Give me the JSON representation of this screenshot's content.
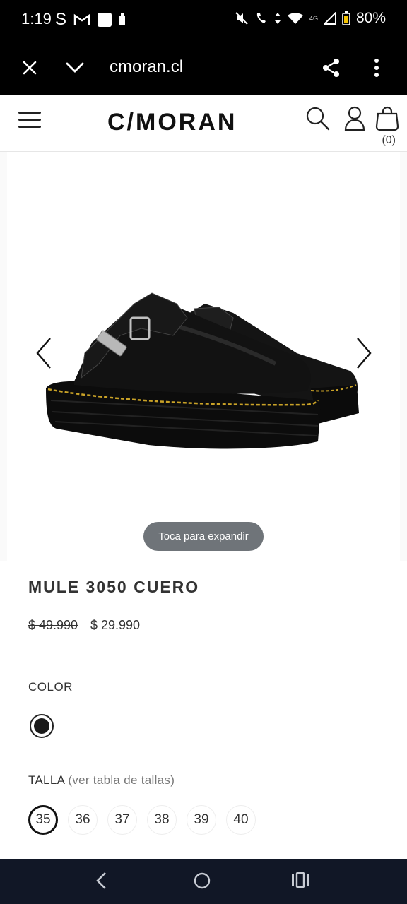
{
  "status_bar": {
    "time": "1:19",
    "battery": "80%"
  },
  "browser": {
    "url": "cmoran.cl"
  },
  "header": {
    "logo": "C/MORAN",
    "cart_count": "(0)"
  },
  "product": {
    "image_hint": "Toca para expandir",
    "title": "MULE 3050 CUERO",
    "old_price": "$ 49.990",
    "price": "$ 29.990",
    "color_label": "COLOR",
    "size_label": "TALLA",
    "size_link": "(ver tabla de tallas)",
    "sizes": [
      "35",
      "36",
      "37",
      "38",
      "39",
      "40"
    ],
    "selected_size": "35"
  },
  "icons": {
    "status_left": [
      "samsung-s-icon",
      "gmail-icon",
      "square-icon",
      "battery-small-icon"
    ],
    "status_right": [
      "mute-icon",
      "wifi-call-icon",
      "data-icon",
      "wifi-icon",
      "4g-icon",
      "signal-icon",
      "battery-icon"
    ],
    "browser": [
      "close-icon",
      "chevron-down-icon",
      "share-icon",
      "more-vert-icon"
    ],
    "header": [
      "menu-icon",
      "search-icon",
      "user-icon",
      "cart-icon"
    ],
    "nav": [
      "back-icon",
      "home-icon",
      "recents-icon"
    ]
  },
  "colors": {
    "bars": "#000000",
    "pill": "#6f7479",
    "nav": "#111726"
  }
}
